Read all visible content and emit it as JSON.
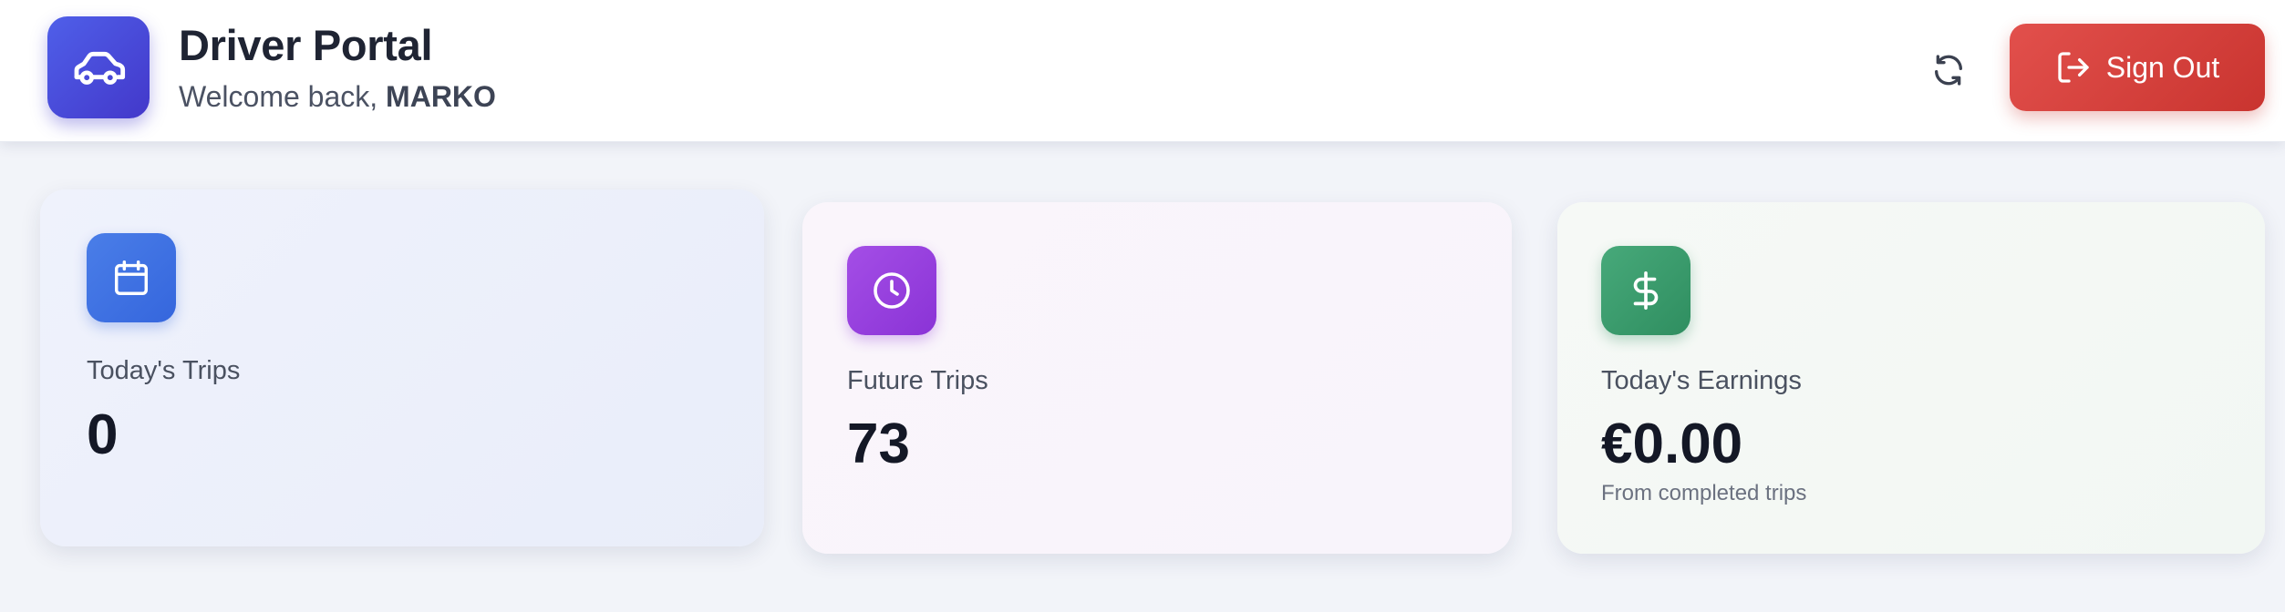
{
  "header": {
    "title": "Driver Portal",
    "welcome_prefix": "Welcome back, ",
    "user_name": "MARKO",
    "brand_icon": "car-icon",
    "refresh_icon": "refresh-icon",
    "signout": {
      "label": "Sign Out",
      "icon": "sign-out-icon"
    }
  },
  "stats": [
    {
      "label": "Today's Trips",
      "value": "0",
      "icon": "calendar-icon",
      "color": "#3f72e4"
    },
    {
      "label": "Future Trips",
      "value": "73",
      "icon": "clock-icon",
      "color": "#9a44e2"
    },
    {
      "label": "Today's Earnings",
      "value": "€0.00",
      "note": "From completed trips",
      "icon": "dollar-icon",
      "color": "#3d9f6f"
    }
  ],
  "colors": {
    "brand": "#4a4fde",
    "signout": "#d9403b",
    "background": "#f2f4f9"
  }
}
